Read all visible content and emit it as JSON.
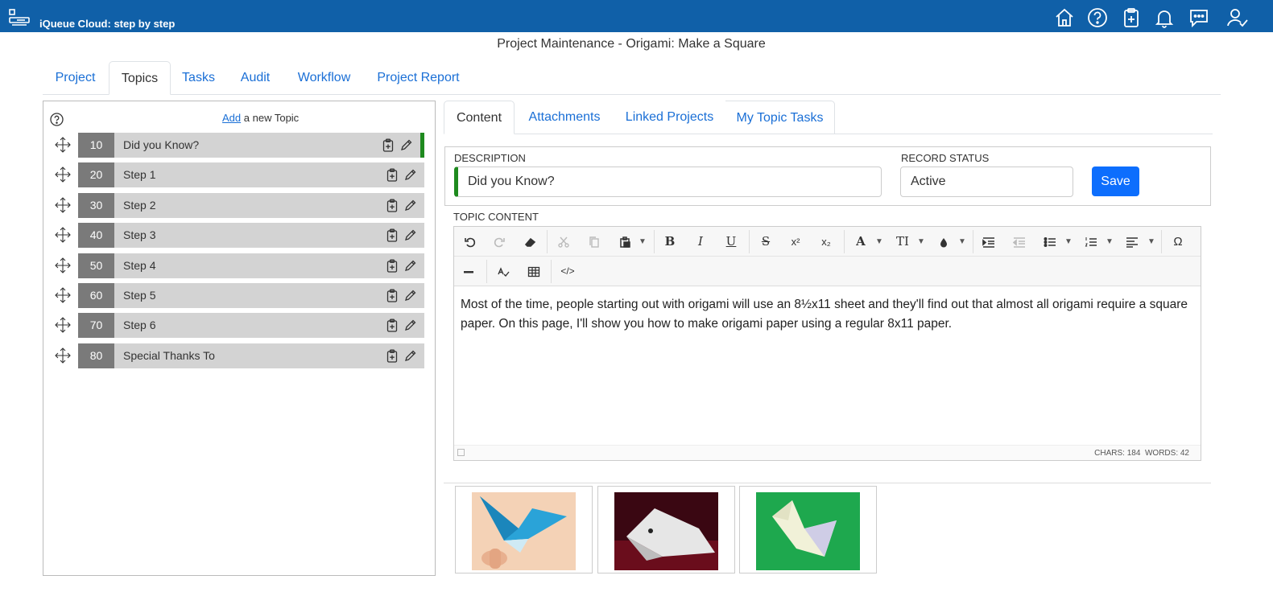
{
  "app": {
    "title": "iQueue Cloud: step by step"
  },
  "header_icons": [
    "home-icon",
    "help-icon",
    "clipboard-add-icon",
    "bell-icon",
    "chat-icon",
    "user-check-icon"
  ],
  "page_title": "Project Maintenance - Origami: Make a Square",
  "main_tabs": [
    "Project",
    "Topics",
    "Tasks",
    "Audit",
    "Workflow",
    "Project Report"
  ],
  "main_tab_active": "Topics",
  "topics_panel": {
    "add_link": "Add",
    "add_suffix": "a new Topic",
    "topics": [
      {
        "num": "10",
        "label": "Did you Know?"
      },
      {
        "num": "20",
        "label": "Step 1"
      },
      {
        "num": "30",
        "label": "Step 2"
      },
      {
        "num": "40",
        "label": "Step 3"
      },
      {
        "num": "50",
        "label": "Step 4"
      },
      {
        "num": "60",
        "label": "Step 5"
      },
      {
        "num": "70",
        "label": "Step 6"
      },
      {
        "num": "80",
        "label": "Special Thanks To"
      }
    ]
  },
  "sub_tabs": [
    "Content",
    "Attachments",
    "Linked Projects",
    "My Topic Tasks"
  ],
  "sub_tab_active": "Content",
  "form": {
    "description_label": "DESCRIPTION",
    "description_value": "Did you Know?",
    "status_label": "RECORD STATUS",
    "status_value": "Active",
    "save_label": "Save"
  },
  "editor": {
    "label": "TOPIC CONTENT",
    "content": "Most of the time, people starting out with origami will use an 8½x11 sheet and they'll find out that almost all origami require a square paper. On this page, I'll show you how to make origami paper using a regular 8x11 paper.",
    "chars": "CHARS: 184",
    "words": "WORDS: 42"
  },
  "colors": {
    "appbar": "#1060a8",
    "link": "#1a6fd6",
    "active_marker": "#1e8a1e",
    "save": "#0d6efd"
  }
}
